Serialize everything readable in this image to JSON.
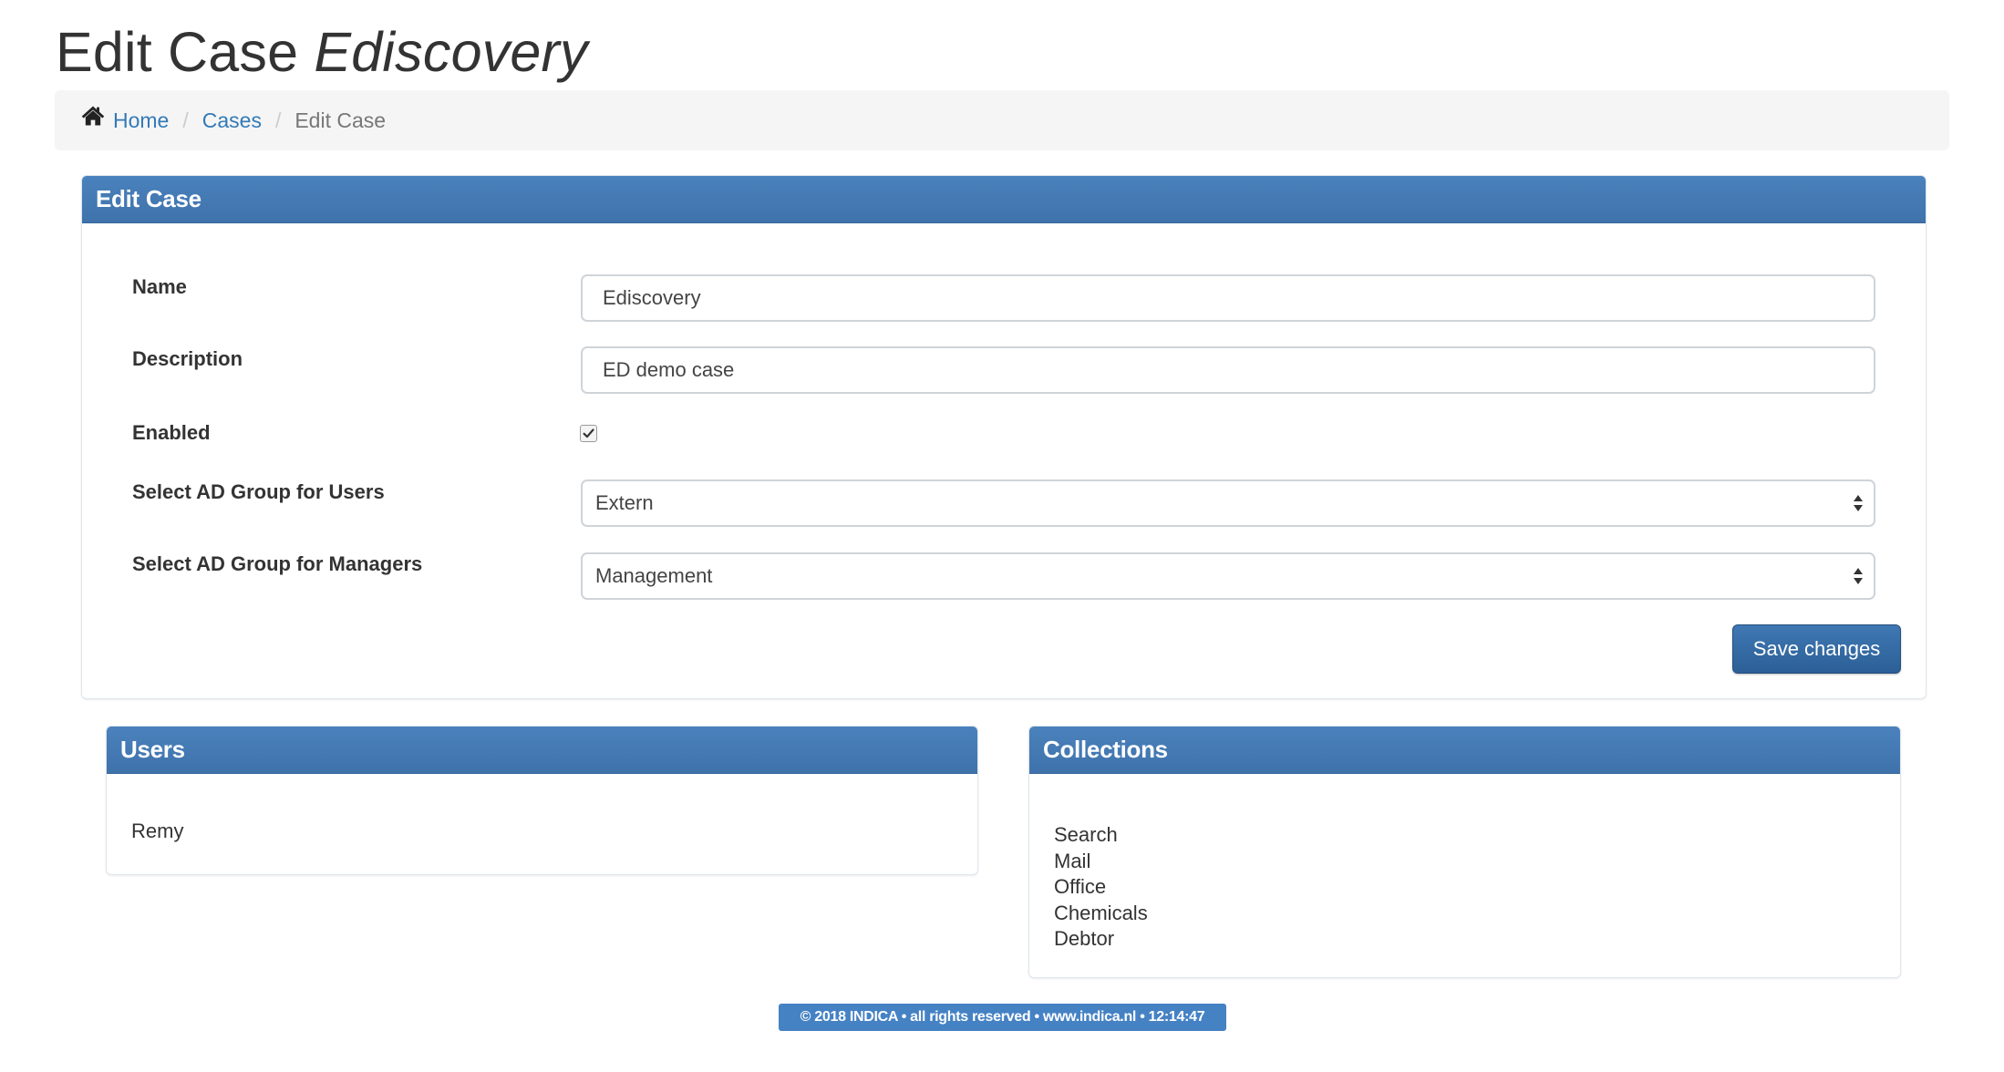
{
  "page_title": {
    "prefix": "Edit Case",
    "case_name": "Ediscovery"
  },
  "breadcrumb": {
    "icon": "home-icon",
    "separator": "/",
    "items": [
      "Home",
      "Cases",
      "Edit Case"
    ]
  },
  "edit_panel": {
    "heading": "Edit Case",
    "fields": {
      "name": {
        "label": "Name",
        "value": "Ediscovery"
      },
      "description": {
        "label": "Description",
        "value": "ED demo case"
      },
      "enabled": {
        "label": "Enabled",
        "checked": true
      },
      "ad_group_users": {
        "label": "Select AD Group for Users",
        "selected": "Extern"
      },
      "ad_group_managers": {
        "label": "Select AD Group for Managers",
        "selected": "Management"
      }
    },
    "save_label": "Save changes"
  },
  "users_panel": {
    "heading": "Users",
    "items": [
      "Remy"
    ]
  },
  "collections_panel": {
    "heading": "Collections",
    "items": [
      "Search",
      "Mail",
      "Office",
      "Chemicals",
      "Debtor"
    ]
  },
  "footer": {
    "text": "© 2018 INDICA • all rights reserved • www.indica.nl • 12:14:47"
  },
  "colors": {
    "panel_heading": "#4279b6",
    "link": "#337ab7",
    "button": "#3670a9",
    "footer_badge": "#4582c4"
  }
}
